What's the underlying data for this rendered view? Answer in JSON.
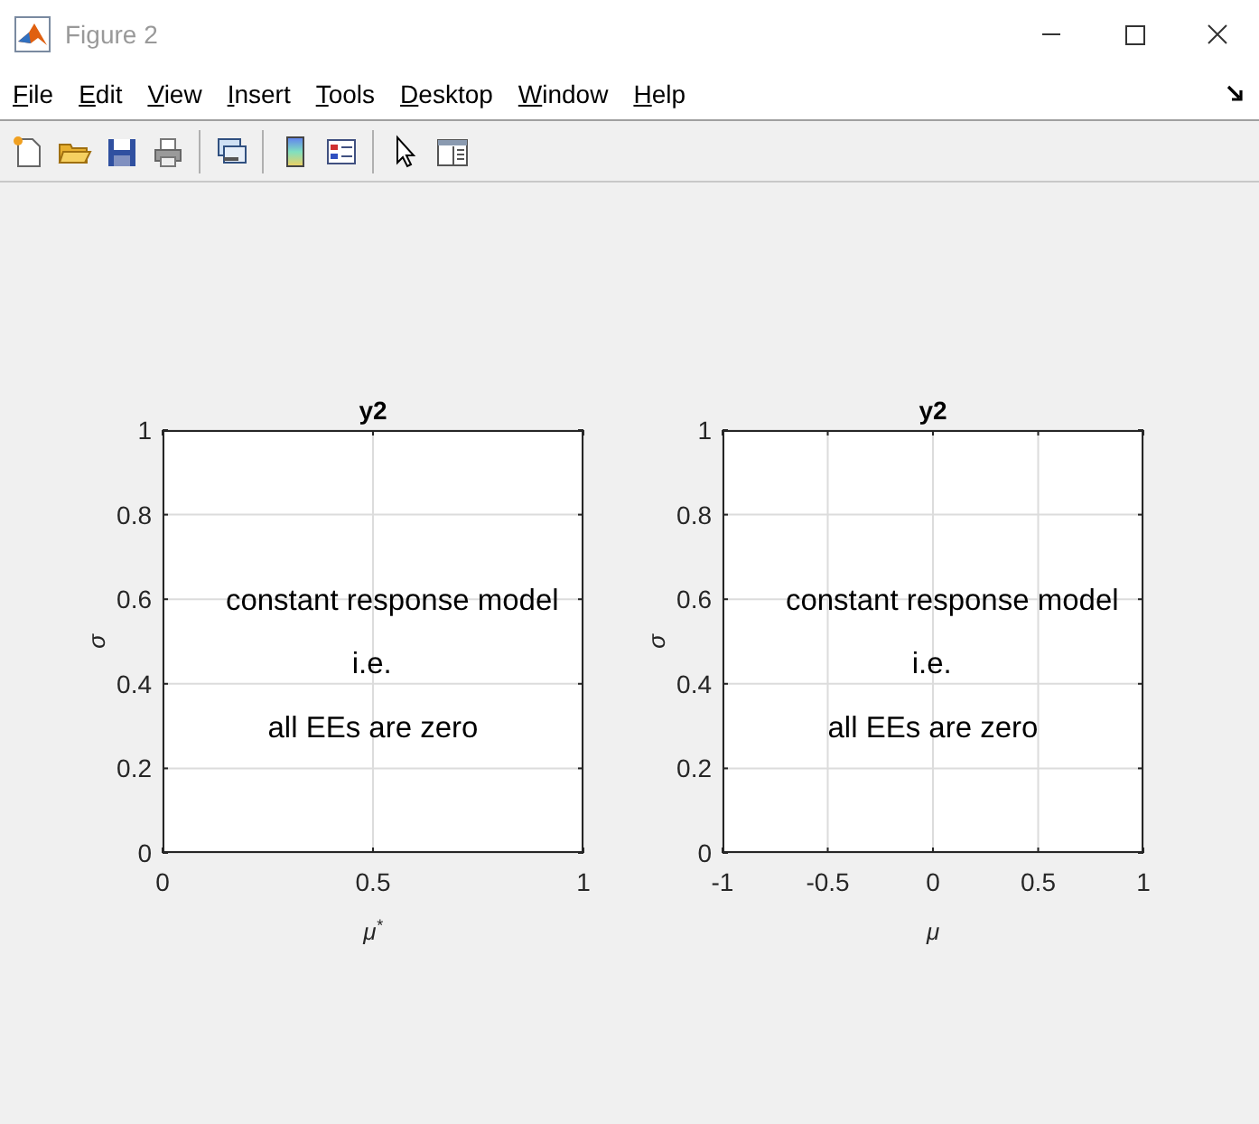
{
  "window": {
    "title": "Figure 2",
    "active": false
  },
  "menu": [
    "File",
    "Edit",
    "View",
    "Insert",
    "Tools",
    "Desktop",
    "Window",
    "Help"
  ],
  "toolbar": [
    {
      "kind": "new"
    },
    {
      "kind": "open"
    },
    {
      "kind": "save"
    },
    {
      "kind": "print"
    },
    {
      "kind": "separator"
    },
    {
      "kind": "link"
    },
    {
      "kind": "separator"
    },
    {
      "kind": "colorbar"
    },
    {
      "kind": "legend"
    },
    {
      "kind": "separator"
    },
    {
      "kind": "pointer"
    },
    {
      "kind": "panel"
    }
  ],
  "axes": [
    {
      "chart_data": {
        "type": "scatter",
        "title": "y2",
        "xlabel": "μ$^{*}$",
        "ylabel": "σ",
        "xlim": [
          0,
          1
        ],
        "ylim": [
          0,
          1
        ],
        "xticks": [
          0,
          0.5,
          1
        ],
        "yticks": [
          0,
          0.2,
          0.4,
          0.6,
          0.8,
          1
        ],
        "grid": true,
        "annotations": [
          "constant response model",
          "i.e.",
          "all EEs are zero"
        ]
      }
    },
    {
      "chart_data": {
        "type": "scatter",
        "title": "y2",
        "xlabel": "μ",
        "ylabel": "σ",
        "xlim": [
          -1,
          1
        ],
        "ylim": [
          0,
          1
        ],
        "xticks": [
          -1,
          -0.5,
          0,
          0.5,
          1
        ],
        "yticks": [
          0,
          0.2,
          0.4,
          0.6,
          0.8,
          1
        ],
        "grid": true,
        "annotations": [
          "constant response model",
          "i.e.",
          "all EEs are zero"
        ]
      }
    }
  ]
}
